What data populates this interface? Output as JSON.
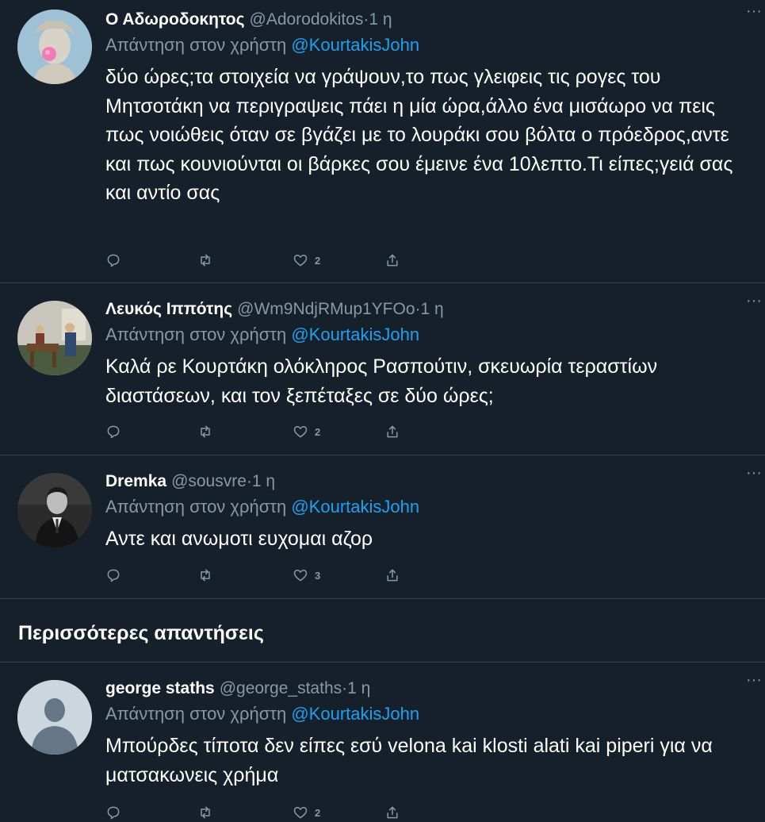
{
  "replies": [
    {
      "name": "Ο Αδωροδοκητος",
      "handle": "@Adorodokitos",
      "dot": "·",
      "time": "1 η",
      "replying_prefix": "Απάντηση στον χρήστη",
      "replying_to": "@KourtakisJohn",
      "text": "δύο ώρες;τα στοιχεία να γράψουν,το πως γλειφεις τις ρογες του Μητσοτάκη να περιγραψεις πάει η μία ώρα,άλλο ένα μισάωρο να πεις πως νοιώθεις όταν σε βγάζει με το λουράκι σου βόλτα ο πρόεδρος,αντε και πως κουνιούνται οι βάρκες σου έμεινε ένα 10λεπτο.Τι είπες;γειά σας και αντίο σας",
      "likes": "2",
      "avatar": "statue-bubblegum"
    },
    {
      "name": "Λευκός Ιππότης",
      "handle": "@Wm9NdjRMup1YFOo",
      "dot": "·",
      "time": "1 η",
      "replying_prefix": "Απάντηση στον χρήστη",
      "replying_to": "@KourtakisJohn",
      "text": "Καλά ρε Κουρτάκη ολόκληρος Ρασπούτιν, σκευωρία τεραστίων διαστάσεων, και τον ξεπέταξες σε δύο ώρες;",
      "likes": "2",
      "avatar": "office-scene"
    },
    {
      "name": "Dremka",
      "handle": "@sousvre",
      "dot": "·",
      "time": "1 η",
      "replying_prefix": "Απάντηση στον χρήστη",
      "replying_to": "@KourtakisJohn",
      "text": "Αντε και ανωμοτι ευχομαι αζορ",
      "likes": "3",
      "avatar": "bw-man-portrait"
    }
  ],
  "more_replies_label": "Περισσότερες απαντήσεις",
  "more_replies": [
    {
      "name": "george staths",
      "handle": "@george_staths",
      "dot": "·",
      "time": "1 η",
      "replying_prefix": "Απάντηση στον χρήστη",
      "replying_to": "@KourtakisJohn",
      "text": "Μπούρδες τίποτα δεν είπες εσύ velona kai klosti alati kai piperi για να ματσακωνεις χρήμα",
      "likes": "2",
      "avatar": "default-avatar"
    }
  ],
  "colors": {
    "background": "#15202b",
    "secondary_text": "#8899a6",
    "mention": "#1da1f2",
    "border": "#38444d"
  }
}
